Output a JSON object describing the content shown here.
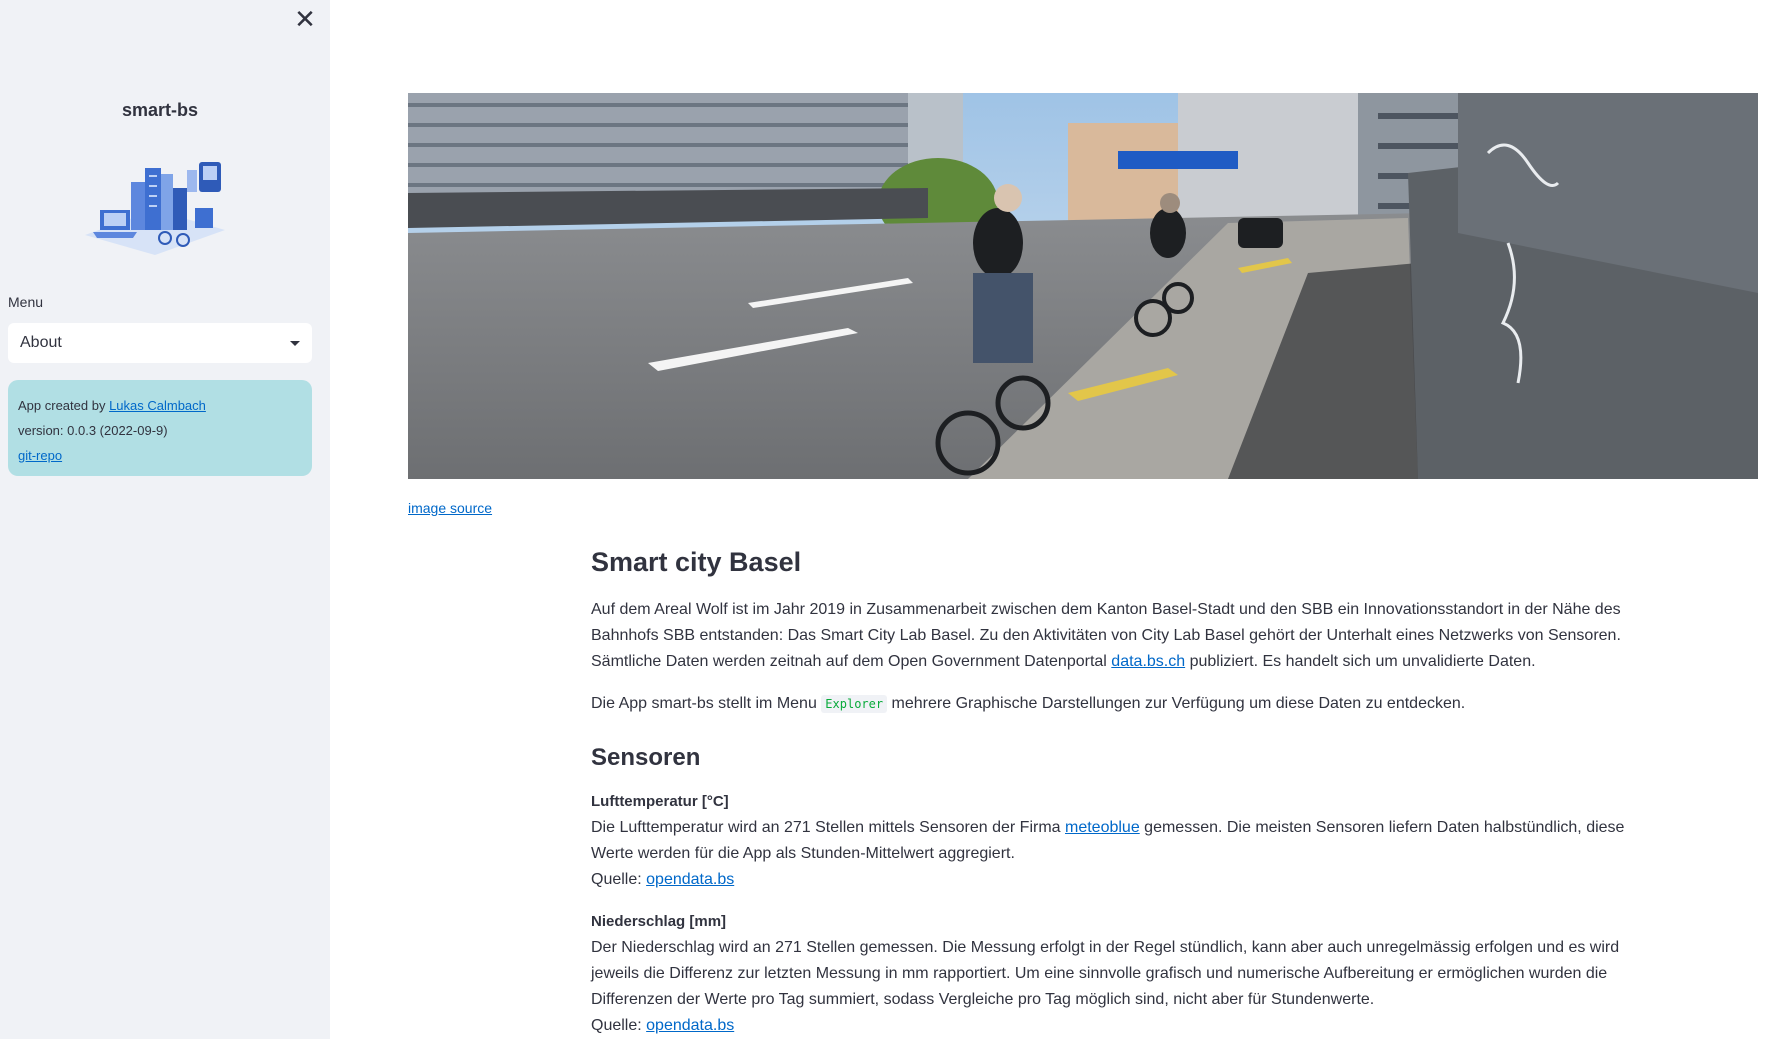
{
  "sidebar": {
    "close_icon": "close-icon",
    "app_title": "smart-bs",
    "menu_label": "Menu",
    "menu_selected": "About",
    "info": {
      "created_prefix": "App created by ",
      "author": "Lukas Calmbach",
      "version": "version: 0.0.3 (2022-09-9)",
      "repo_link": "git-repo"
    }
  },
  "main": {
    "image_source_link": "image source",
    "title": "Smart city Basel",
    "intro": {
      "before_link": "Auf dem Areal Wolf ist im Jahr 2019 in Zusammenarbeit zwischen dem Kanton Basel-Stadt und den SBB ein Innovationsstandort in der Nähe des Bahnhofs SBB entstanden: Das Smart City Lab Basel. Zu den Aktivitäten von City Lab Basel gehört der Unterhalt eines Netzwerks von Sensoren. Sämtliche Daten werden zeitnah auf dem Open Government Datenportal ",
      "link": "data.bs.ch",
      "after_link": " publiziert. Es handelt sich um unvalidierte Daten."
    },
    "explorer_para": {
      "before_code": "Die App smart-bs stellt im Menu ",
      "code": "Explorer",
      "after_code": " mehrere Graphische Darstellungen zur Verfügung um diese Daten zu entdecken."
    },
    "sensors_heading": "Sensoren",
    "sensors": [
      {
        "title": "Lufttemperatur [°C]",
        "text_before": "Die Lufttemperatur wird an 271 Stellen mittels Sensoren der Firma ",
        "link": "meteoblue",
        "text_after": " gemessen. Die meisten Sensoren liefern Daten halbstündlich, diese Werte werden für die App als Stunden-Mittelwert aggregiert.",
        "source_label": "Quelle: ",
        "source_link": "opendata.bs"
      },
      {
        "title": "Niederschlag [mm]",
        "text_before": "Der Niederschlag wird an 271 Stellen gemessen. Die Messung erfolgt in der Regel stündlich, kann aber auch unregelmässig erfolgen und es wird jeweils die Differenz zur letzten Messung in mm rapportiert. Um eine sinnvolle grafisch und numerische Aufbereitung er ermöglichen wurden die Differenzen der Werte pro Tag summiert, sodass Vergleiche pro Tag möglich sind, nicht aber für Stundenwerte.",
        "link": "",
        "text_after": "",
        "source_label": "Quelle: ",
        "source_link": "opendata.bs"
      }
    ]
  },
  "colors": {
    "sidebar_bg": "#f0f2f6",
    "info_bg": "#b1dfe4",
    "link": "#0068c9",
    "code": "#09ab3b"
  }
}
